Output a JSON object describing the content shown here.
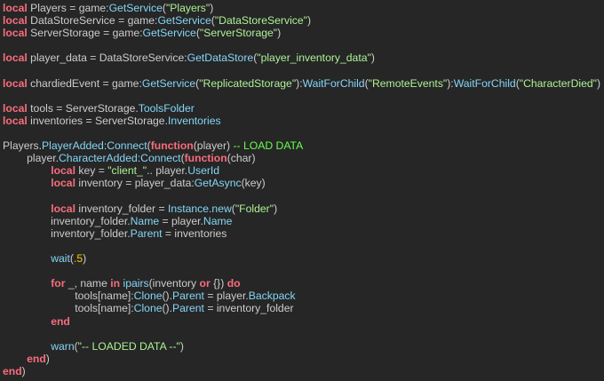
{
  "palette": {
    "background": "#262626",
    "keyword": "#f86d7c",
    "builtin": "#84d6f7",
    "string": "#adf195",
    "number": "#ffc600",
    "comment": "#66ff4c",
    "text": "#cccccc"
  },
  "code": {
    "lines": [
      [
        [
          "kw",
          "local"
        ],
        [
          "plain",
          " Players = game:"
        ],
        [
          "fn",
          "GetService"
        ],
        [
          "plain",
          "("
        ],
        [
          "str",
          "\"Players\""
        ],
        [
          "plain",
          ")"
        ]
      ],
      [
        [
          "kw",
          "local"
        ],
        [
          "plain",
          " DataStoreService = game:"
        ],
        [
          "fn",
          "GetService"
        ],
        [
          "plain",
          "("
        ],
        [
          "str",
          "\"DataStoreService\""
        ],
        [
          "plain",
          ")"
        ]
      ],
      [
        [
          "kw",
          "local"
        ],
        [
          "plain",
          " ServerStorage = game:"
        ],
        [
          "fn",
          "GetService"
        ],
        [
          "plain",
          "("
        ],
        [
          "str",
          "\"ServerStorage\""
        ],
        [
          "plain",
          ")"
        ]
      ],
      [],
      [
        [
          "kw",
          "local"
        ],
        [
          "plain",
          " player_data = DataStoreService:"
        ],
        [
          "fn",
          "GetDataStore"
        ],
        [
          "plain",
          "("
        ],
        [
          "str",
          "\"player_inventory_data\""
        ],
        [
          "plain",
          ")"
        ]
      ],
      [],
      [
        [
          "kw",
          "local"
        ],
        [
          "plain",
          " chardiedEvent = game:"
        ],
        [
          "fn",
          "GetService"
        ],
        [
          "plain",
          "("
        ],
        [
          "str",
          "\"ReplicatedStorage\""
        ],
        [
          "plain",
          "):"
        ],
        [
          "fn",
          "WaitForChild"
        ],
        [
          "plain",
          "("
        ],
        [
          "str",
          "\"RemoteEvents\""
        ],
        [
          "plain",
          "):"
        ],
        [
          "fn",
          "WaitForChild"
        ],
        [
          "plain",
          "("
        ],
        [
          "str",
          "\"CharacterDied\""
        ],
        [
          "plain",
          ")"
        ]
      ],
      [],
      [
        [
          "kw",
          "local"
        ],
        [
          "plain",
          " tools = ServerStorage."
        ],
        [
          "fn",
          "ToolsFolder"
        ]
      ],
      [
        [
          "kw",
          "local"
        ],
        [
          "plain",
          " inventories = ServerStorage."
        ],
        [
          "fn",
          "Inventories"
        ]
      ],
      [],
      [
        [
          "plain",
          "Players."
        ],
        [
          "fn",
          "PlayerAdded"
        ],
        [
          "plain",
          ":"
        ],
        [
          "fn",
          "Connect"
        ],
        [
          "plain",
          "("
        ],
        [
          "kw",
          "function"
        ],
        [
          "plain",
          "(player) "
        ],
        [
          "com",
          "-- LOAD DATA"
        ]
      ],
      [
        [
          "plain",
          "        player."
        ],
        [
          "fn",
          "CharacterAdded"
        ],
        [
          "plain",
          ":"
        ],
        [
          "fn",
          "Connect"
        ],
        [
          "plain",
          "("
        ],
        [
          "kw",
          "function"
        ],
        [
          "plain",
          "(char)"
        ]
      ],
      [
        [
          "plain",
          "                "
        ],
        [
          "kw",
          "local"
        ],
        [
          "plain",
          " key = "
        ],
        [
          "str",
          "\"client_\""
        ],
        [
          "plain",
          ".. player."
        ],
        [
          "fn",
          "UserId"
        ]
      ],
      [
        [
          "plain",
          "                "
        ],
        [
          "kw",
          "local"
        ],
        [
          "plain",
          " inventory = player_data:"
        ],
        [
          "fn",
          "GetAsync"
        ],
        [
          "plain",
          "(key)"
        ]
      ],
      [],
      [
        [
          "plain",
          "                "
        ],
        [
          "kw",
          "local"
        ],
        [
          "plain",
          " inventory_folder = "
        ],
        [
          "fn",
          "Instance.new"
        ],
        [
          "plain",
          "("
        ],
        [
          "str",
          "\"Folder\""
        ],
        [
          "plain",
          ")"
        ]
      ],
      [
        [
          "plain",
          "                inventory_folder."
        ],
        [
          "fn",
          "Name"
        ],
        [
          "plain",
          " = player."
        ],
        [
          "fn",
          "Name"
        ]
      ],
      [
        [
          "plain",
          "                inventory_folder."
        ],
        [
          "fn",
          "Parent"
        ],
        [
          "plain",
          " = inventories"
        ]
      ],
      [],
      [
        [
          "plain",
          "                "
        ],
        [
          "fn",
          "wait"
        ],
        [
          "plain",
          "("
        ],
        [
          "num",
          ".5"
        ],
        [
          "plain",
          ")"
        ]
      ],
      [],
      [
        [
          "plain",
          "                "
        ],
        [
          "kw",
          "for"
        ],
        [
          "plain",
          " _, name "
        ],
        [
          "kw",
          "in"
        ],
        [
          "plain",
          " "
        ],
        [
          "fn",
          "ipairs"
        ],
        [
          "plain",
          "(inventory "
        ],
        [
          "kw",
          "or"
        ],
        [
          "plain",
          " {}) "
        ],
        [
          "kw",
          "do"
        ]
      ],
      [
        [
          "plain",
          "                        tools[name]:"
        ],
        [
          "fn",
          "Clone"
        ],
        [
          "plain",
          "()."
        ],
        [
          "fn",
          "Parent"
        ],
        [
          "plain",
          " = player."
        ],
        [
          "fn",
          "Backpack"
        ]
      ],
      [
        [
          "plain",
          "                        tools[name]:"
        ],
        [
          "fn",
          "Clone"
        ],
        [
          "plain",
          "()."
        ],
        [
          "fn",
          "Parent"
        ],
        [
          "plain",
          " = inventory_folder"
        ]
      ],
      [
        [
          "plain",
          "                "
        ],
        [
          "kw",
          "end"
        ]
      ],
      [],
      [
        [
          "plain",
          "                "
        ],
        [
          "fn",
          "warn"
        ],
        [
          "plain",
          "("
        ],
        [
          "str",
          "\"-- LOADED DATA --\""
        ],
        [
          "plain",
          ")"
        ]
      ],
      [
        [
          "plain",
          "        "
        ],
        [
          "kw",
          "end"
        ],
        [
          "plain",
          ")"
        ]
      ],
      [
        [
          "kw",
          "end"
        ],
        [
          "plain",
          ")"
        ]
      ]
    ]
  }
}
